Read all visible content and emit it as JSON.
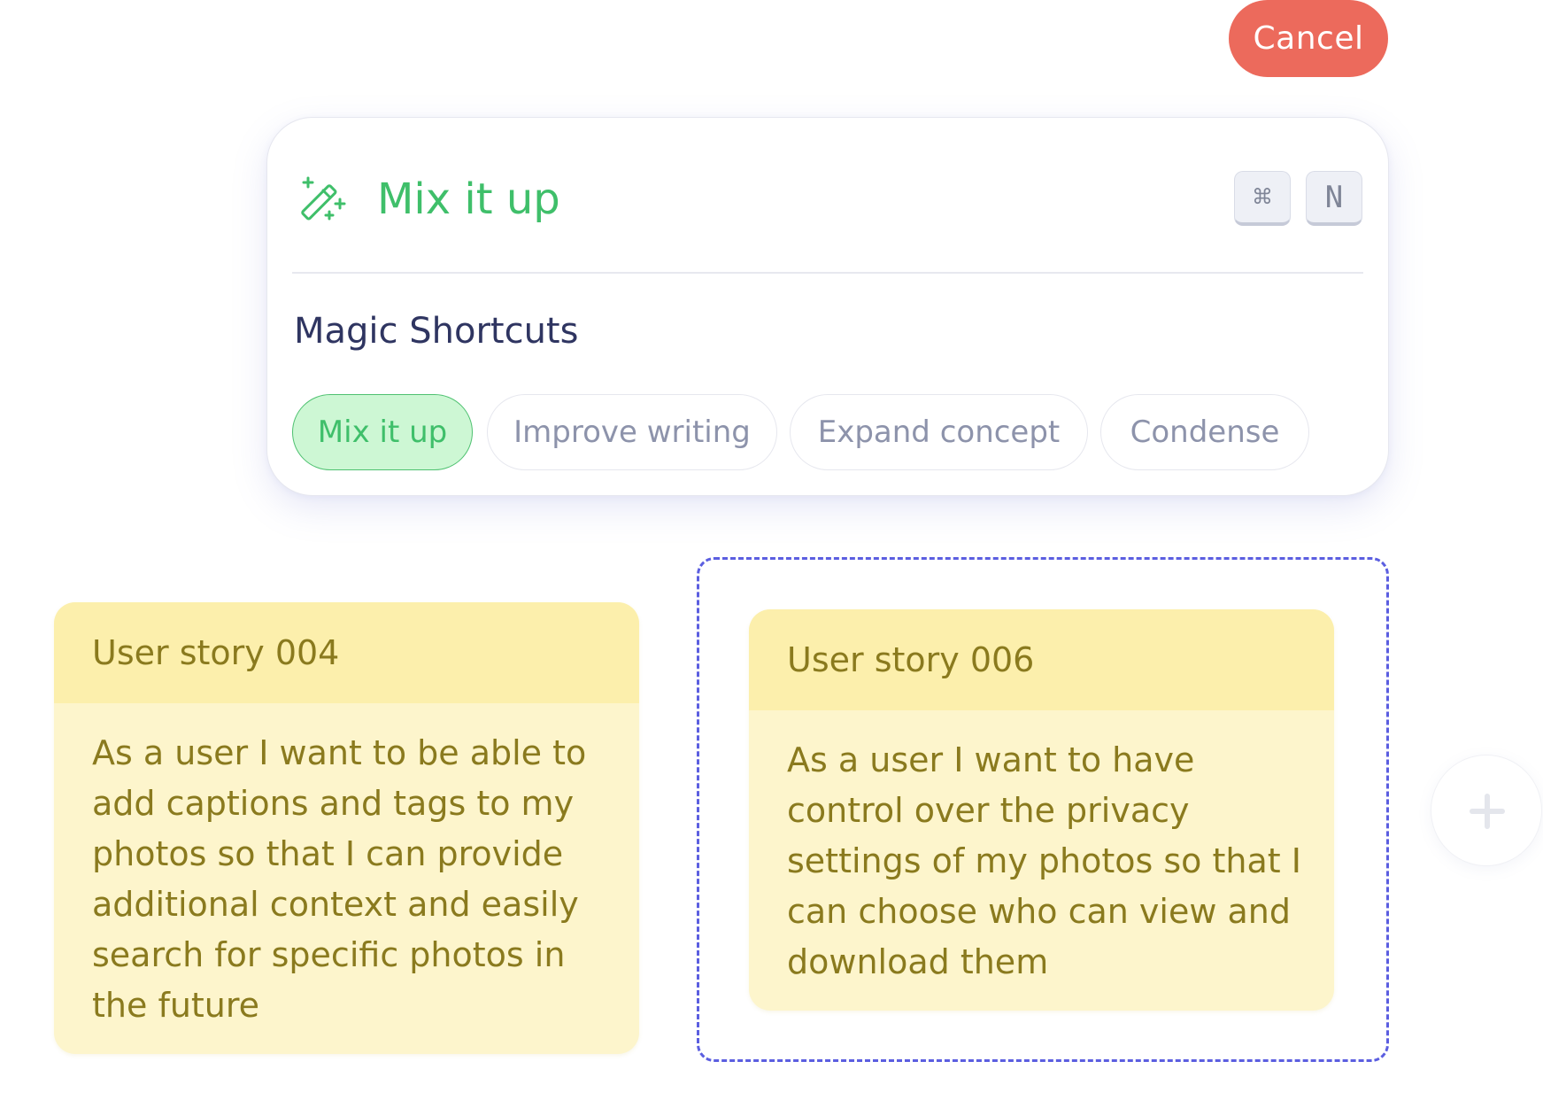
{
  "cancel_button": {
    "label": "Cancel"
  },
  "magic_panel": {
    "title": "Mix it up",
    "title_icon": "magic-wand-icon",
    "shortcut_keys": [
      "⌘",
      "N"
    ],
    "section_title": "Magic Shortcuts",
    "shortcuts": [
      {
        "label": "Mix it up",
        "active": true
      },
      {
        "label": "Improve writing",
        "active": false
      },
      {
        "label": "Expand concept",
        "active": false
      },
      {
        "label": "Condense",
        "active": false
      }
    ]
  },
  "notes": [
    {
      "title": "User story 004",
      "body": "As a user I want to be able to add captions and tags to my photos so that I can provide additional context and easily search for specific photos in the future",
      "selected": false
    },
    {
      "title": "User story 006",
      "body": "As a user I want to have control over the privacy settings of my photos so that I can choose who can view and download them",
      "selected": true
    }
  ],
  "add_button": {
    "icon": "plus-icon"
  },
  "colors": {
    "accent_green": "#3fbf6a",
    "cancel_red": "#ec6a5c",
    "selection_blue": "#5b5ee0",
    "note_yellow": "#fdf5cc",
    "note_header_yellow": "#fcefac",
    "note_text": "#8a7a1e"
  }
}
